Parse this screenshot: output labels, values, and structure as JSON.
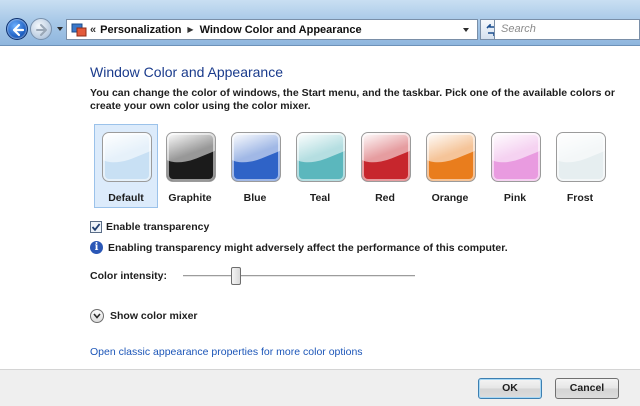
{
  "addressbar": {
    "chevron": "«",
    "crumbs": [
      "Personalization",
      "Window Color and Appearance"
    ],
    "search_placeholder": "Search"
  },
  "page": {
    "title": "Window Color and Appearance",
    "description": "You can change the color of windows, the Start menu, and the taskbar. Pick one of the available colors or create your own color using the color mixer."
  },
  "swatches": [
    {
      "label": "Default",
      "color": "#c8e0f4",
      "selected": true
    },
    {
      "label": "Graphite",
      "color": "#1b1b1b",
      "selected": false
    },
    {
      "label": "Blue",
      "color": "#2f63c7",
      "selected": false
    },
    {
      "label": "Teal",
      "color": "#5bb7bd",
      "selected": false
    },
    {
      "label": "Red",
      "color": "#c7262d",
      "selected": false
    },
    {
      "label": "Orange",
      "color": "#e97d1d",
      "selected": false
    },
    {
      "label": "Pink",
      "color": "#e99be0",
      "selected": false
    },
    {
      "label": "Frost",
      "color": "#e6eef0",
      "selected": false
    }
  ],
  "transparency": {
    "label": "Enable transparency",
    "checked": true,
    "info": "Enabling transparency might adversely affect the performance of this computer."
  },
  "intensity": {
    "label": "Color intensity:",
    "value_fraction": 0.23
  },
  "mixer": {
    "label": "Show color mixer"
  },
  "classic_link": "Open classic appearance properties for more color options",
  "buttons": {
    "ok": "OK",
    "cancel": "Cancel"
  }
}
